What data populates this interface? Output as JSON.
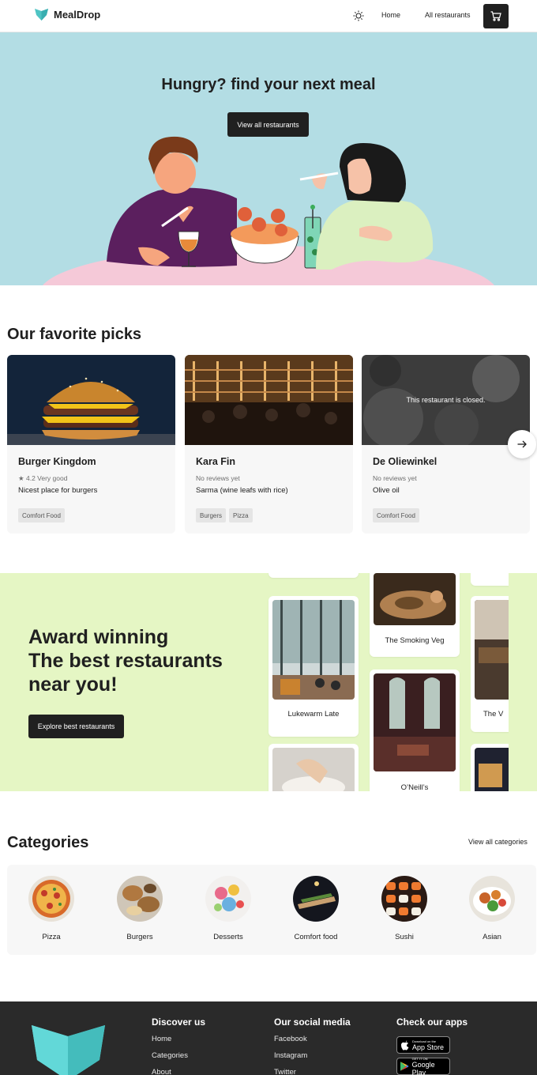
{
  "header": {
    "brand": "MealDrop",
    "nav": [
      {
        "label": "Home"
      },
      {
        "label": "All restaurants"
      }
    ],
    "icons": {
      "logo": "fox-head-logo",
      "theme": "sun-icon",
      "cart": "cart-icon"
    }
  },
  "hero": {
    "title": "Hungry? find your next meal",
    "cta": "View all restaurants"
  },
  "picks": {
    "title": "Our favorite picks",
    "cards": [
      {
        "name": "Burger Kingdom",
        "rating": "★ 4.2 Very good",
        "description": "Nicest place for burgers",
        "tags": [
          "Comfort Food"
        ],
        "closed_text": ""
      },
      {
        "name": "Kara Fin",
        "rating": "No reviews yet",
        "description": "Sarma (wine leafs with rice)",
        "tags": [
          "Burgers",
          "Pizza"
        ],
        "closed_text": ""
      },
      {
        "name": "De Oliewinkel",
        "rating": "No reviews yet",
        "description": "Olive oil",
        "tags": [
          "Comfort Food"
        ],
        "closed_text": "This restaurant is closed."
      }
    ],
    "next_icon": "arrow-right-icon"
  },
  "award": {
    "line1": "Award winning",
    "line2": "The best restaurants",
    "line3": "near you!",
    "cta": "Explore best restaurants",
    "restaurants": [
      {
        "name": "Lukewarm Late"
      },
      {
        "name": "The Smoking Veg"
      },
      {
        "name": "O’Neill’s"
      },
      {
        "name": "The V"
      }
    ]
  },
  "categories": {
    "title": "Categories",
    "view_all": "View all categories",
    "items": [
      {
        "label": "Pizza"
      },
      {
        "label": "Burgers"
      },
      {
        "label": "Desserts"
      },
      {
        "label": "Comfort food"
      },
      {
        "label": "Sushi"
      },
      {
        "label": "Asian"
      }
    ]
  },
  "footer": {
    "discover": {
      "title": "Discover us",
      "links": [
        "Home",
        "Categories",
        "About"
      ]
    },
    "social": {
      "title": "Our social media",
      "links": [
        "Facebook",
        "Instagram",
        "Twitter"
      ]
    },
    "apps": {
      "title": "Check our apps",
      "app_store_small": "Download on the",
      "app_store": "App Store",
      "google_small": "GET IT ON",
      "google": "Google Play"
    }
  },
  "colors": {
    "dark": "#202020",
    "hero_bg": "#b3dde4",
    "award_bg": "#e5f6c4",
    "footer_bg": "#2a2a2a",
    "logo_teal": "#4fc4c4"
  }
}
